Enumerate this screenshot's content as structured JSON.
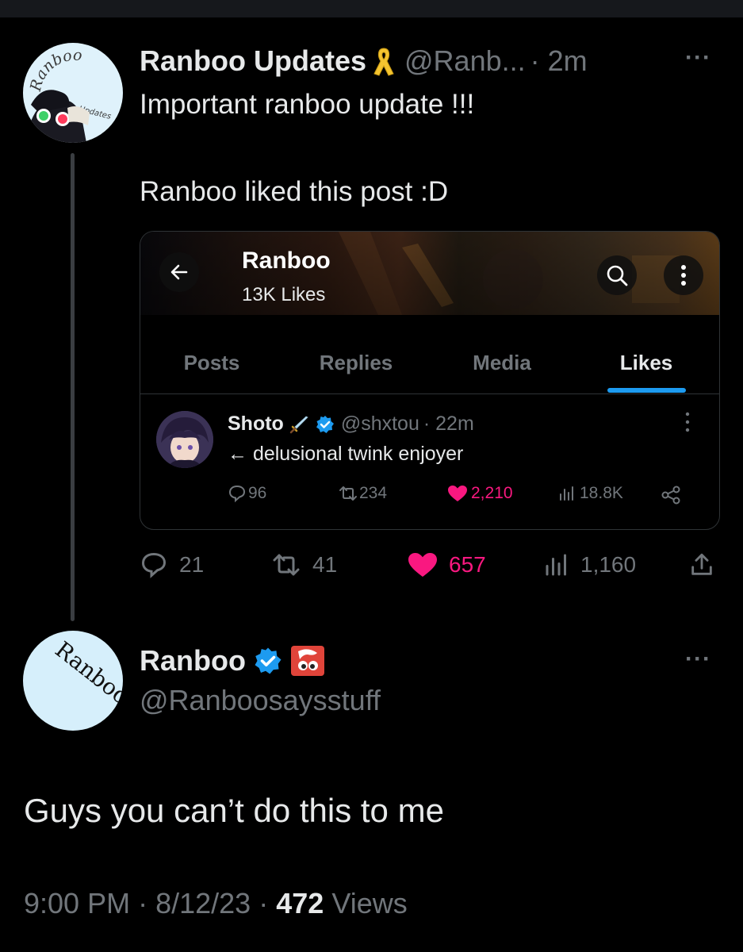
{
  "colors": {
    "accent": "#1d9bf0",
    "like": "#f91880",
    "muted": "#71767b",
    "text": "#e7e9ea",
    "background": "#000000"
  },
  "quote_tweet": {
    "author_name": "Ranboo Updates",
    "author_badge_icon": "yellow-ribbon-icon",
    "handle": "@Ranb...",
    "time": "· 2m",
    "more": "···",
    "text_line1": "Important ranboo update !!!",
    "text_line2": "Ranboo liked this post :D",
    "avatar_text": "Ranboo",
    "avatar_subtext": "Updates",
    "stats": {
      "replies": "21",
      "reposts": "41",
      "likes": "657",
      "views": "1,160"
    }
  },
  "embedded_screenshot": {
    "profile_name": "Ranboo",
    "profile_likes": "13K Likes",
    "tabs": [
      "Posts",
      "Replies",
      "Media",
      "Likes"
    ],
    "active_tab": "Likes",
    "post": {
      "author_name": "Shoto",
      "handle": "@shxtou",
      "time": "· 22m",
      "text": "← delusional twink enjoyer",
      "stats": {
        "replies": "96",
        "reposts": "234",
        "likes": "2,210",
        "views": "18.8K"
      }
    }
  },
  "main_tweet": {
    "author_name": "Ranboo",
    "handle": "@Ranboosaysstuff",
    "more": "···",
    "avatar_text": "Ranboo",
    "text": "Guys you can’t do this to me",
    "time": "9:00 PM",
    "date": "8/12/23",
    "views_count": "472",
    "views_label": "Views"
  }
}
